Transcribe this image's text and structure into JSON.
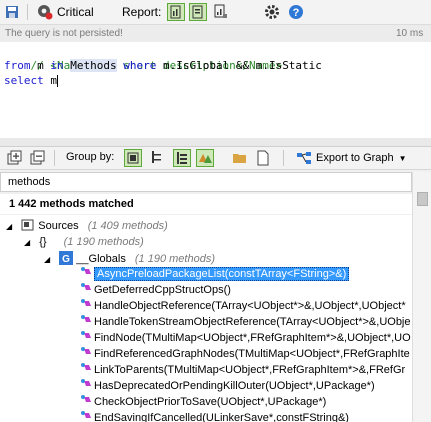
{
  "toolbar": {
    "severity_label": "Critical",
    "report_label": "Report:"
  },
  "status": {
    "message": "The query is not persisted!",
    "time": "10 ms"
  },
  "editor": {
    "line1": "// <Name>TODO short description</Name>",
    "l2_from": "from",
    "l2_m": " m ",
    "l2_in": "in",
    "l2_methods": "Methods",
    "l2_where": "where",
    "l2_rest": " m.IsGlobal && m.IsStatic",
    "l3_select": "select",
    "l3_rest": " m"
  },
  "toolbar2": {
    "group_by_label": "Group by:",
    "export_label": "Export to Graph",
    "export_accel": "G"
  },
  "filter": {
    "value": "methods"
  },
  "results": {
    "count_label": "1 442 methods matched"
  },
  "tree": {
    "sources": {
      "label": "Sources",
      "sub": "(1 409 methods)"
    },
    "namespace": {
      "label": "{}",
      "sub": "(1 190 methods)"
    },
    "globals": {
      "label": "__Globals",
      "sub": "(1 190 methods)"
    },
    "methods": [
      "AsyncPreloadPackageList(constTArray<FString>&)",
      "GetDeferredCppStructOps()",
      "HandleObjectReference(TArray<UObject*>&,UObject*,UObject*",
      "HandleTokenStreamObjectReference(TArray<UObject*>&,UObje",
      "FindNode(TMultiMap<UObject*,FRefGraphItem*>&,UObject*,UO",
      "FindReferencedGraphNodes(TMultiMap<UObject*,FRefGraphIte",
      "LinkToParents(TMultiMap<UObject*,FRefGraphItem*>&,FRefGr",
      "HasDeprecatedOrPendingKillOuter(UObject*,UPackage*)",
      "CheckObjectPriorToSave(UObject*,UPackage*)",
      "EndSavingIfCancelled(ULinkerSave*,constFString&)"
    ]
  },
  "colors": {
    "selection": "#3399ff",
    "accent_green": "#5fa83c",
    "help_blue": "#2f78d6"
  }
}
